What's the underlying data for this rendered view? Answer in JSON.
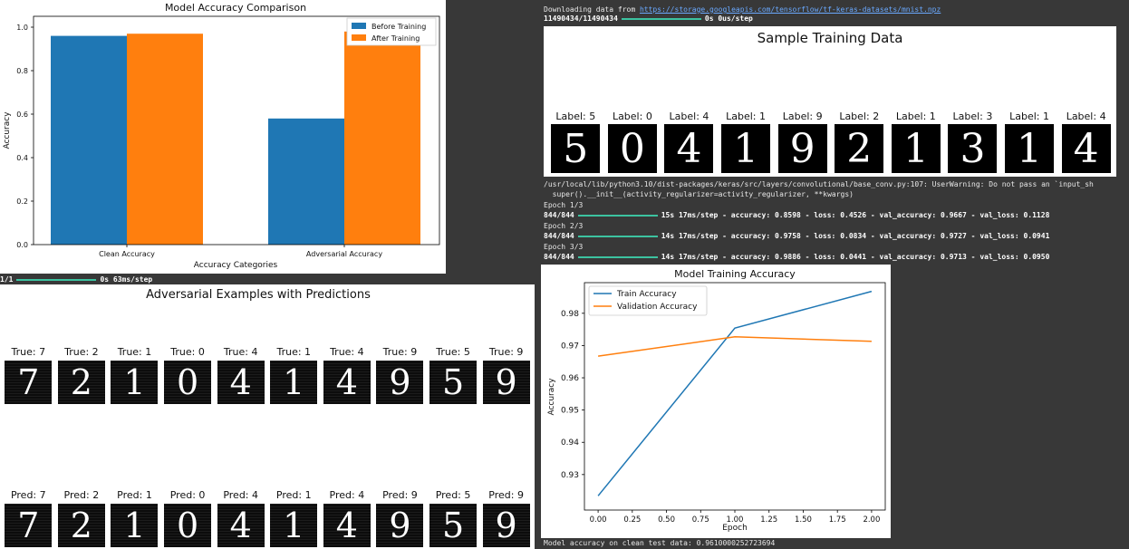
{
  "console": {
    "download_prefix": "Downloading data from ",
    "download_url": "https://storage.googleapis.com/tensorflow/tf-keras-datasets/mnist.npz",
    "download_progress_left": "11490434/11490434",
    "download_progress_right": "0s 0us/step",
    "warning_line1": "/usr/local/lib/python3.10/dist-packages/keras/src/layers/convolutional/base_conv.py:107: UserWarning: Do not pass an `input_sh",
    "warning_line2": "  super().__init__(activity_regularizer=activity_regularizer, **kwargs)",
    "epochs": [
      {
        "header": "Epoch 1/3",
        "steps": "844/844",
        "stats": "15s 17ms/step - accuracy: 0.8598 - loss: 0.4526 - val_accuracy: 0.9667 - val_loss: 0.1128"
      },
      {
        "header": "Epoch 2/3",
        "steps": "844/844",
        "stats": "14s 17ms/step - accuracy: 0.9758 - loss: 0.0834 - val_accuracy: 0.9727 - val_loss: 0.0941"
      },
      {
        "header": "Epoch 3/3",
        "steps": "844/844",
        "stats": "14s 17ms/step - accuracy: 0.9886 - loss: 0.0441 - val_accuracy: 0.9713 - val_loss: 0.0950"
      }
    ],
    "predict_left": "1/1",
    "predict_right": "0s 63ms/step",
    "final_line": "Model accuracy on clean test data: 0.9610000252723694"
  },
  "sample_data": {
    "title": "Sample Training Data",
    "labels": [
      "Label: 5",
      "Label: 0",
      "Label: 4",
      "Label: 1",
      "Label: 9",
      "Label: 2",
      "Label: 1",
      "Label: 3",
      "Label: 1",
      "Label: 4"
    ],
    "digits": [
      "5",
      "0",
      "4",
      "1",
      "9",
      "2",
      "1",
      "3",
      "1",
      "4"
    ]
  },
  "adversarial": {
    "title": "Adversarial Examples with Predictions",
    "true_labels": [
      "True: 7",
      "True: 2",
      "True: 1",
      "True: 0",
      "True: 4",
      "True: 1",
      "True: 4",
      "True: 9",
      "True: 5",
      "True: 9"
    ],
    "pred_labels": [
      "Pred: 7",
      "Pred: 2",
      "Pred: 1",
      "Pred: 0",
      "Pred: 4",
      "Pred: 1",
      "Pred: 4",
      "Pred: 9",
      "Pred: 5",
      "Pred: 9"
    ],
    "digits": [
      "7",
      "2",
      "1",
      "0",
      "4",
      "1",
      "4",
      "9",
      "5",
      "9"
    ]
  },
  "chart_data": [
    {
      "type": "bar",
      "title": "Model Accuracy Comparison",
      "xlabel": "Accuracy Categories",
      "ylabel": "Accuracy",
      "categories": [
        "Clean Accuracy",
        "Adversarial Accuracy"
      ],
      "series": [
        {
          "name": "Before Training",
          "values": [
            0.96,
            0.58
          ],
          "color": "#1f77b4"
        },
        {
          "name": "After Training",
          "values": [
            0.97,
            0.98
          ],
          "color": "#ff7f0e"
        }
      ],
      "ylim": [
        0,
        1.0
      ],
      "yticks": [
        "0.0",
        "0.2",
        "0.4",
        "0.6",
        "0.8",
        "1.0"
      ],
      "legend": "top-right"
    },
    {
      "type": "line",
      "title": "Model Training Accuracy",
      "xlabel": "Epoch",
      "ylabel": "Accuracy",
      "x": [
        0,
        1,
        2
      ],
      "series": [
        {
          "name": "Train Accuracy",
          "values": [
            0.9234,
            0.9754,
            0.9868
          ],
          "color": "#1f77b4"
        },
        {
          "name": "Validation Accuracy",
          "values": [
            0.9667,
            0.9727,
            0.9713
          ],
          "color": "#ff7f0e"
        }
      ],
      "xlim": [
        -0.1,
        2.1
      ],
      "ylim": [
        0.919,
        0.9895
      ],
      "xticks": [
        "0.00",
        "0.25",
        "0.50",
        "0.75",
        "1.00",
        "1.25",
        "1.50",
        "1.75",
        "2.00"
      ],
      "yticks": [
        "0.93",
        "0.94",
        "0.95",
        "0.96",
        "0.97",
        "0.98"
      ],
      "legend": "top-left"
    }
  ]
}
